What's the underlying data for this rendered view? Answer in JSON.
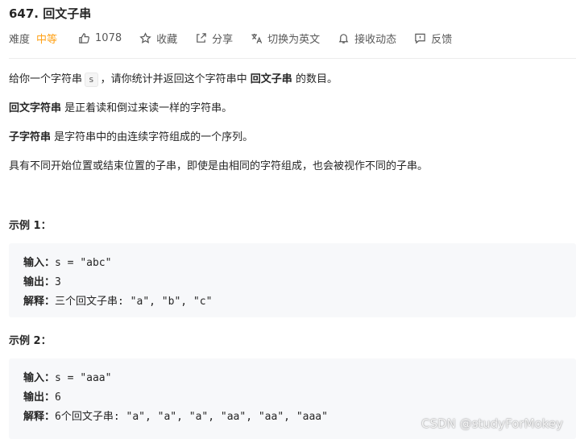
{
  "problem": {
    "title": "647. 回文子串"
  },
  "toolbar": {
    "difficulty_label": "难度",
    "difficulty_value": "中等",
    "likes": "1078",
    "favorite": "收藏",
    "share": "分享",
    "switch_lang": "切换为英文",
    "notifications": "接收动态",
    "feedback": "反馈"
  },
  "description": {
    "p1_a": "给你一个字符串",
    "p1_code": "s",
    "p1_b": "，请你统计并返回这个字符串中",
    "p1_bold": "回文子串",
    "p1_c": "的数目。",
    "p2_bold": "回文字符串",
    "p2_rest": "是正着读和倒过来读一样的字符串。",
    "p3_bold": "子字符串",
    "p3_rest": "是字符串中的由连续字符组成的一个序列。",
    "p4": "具有不同开始位置或结束位置的子串，即使是由相同的字符组成，也会被视作不同的子串。"
  },
  "examples": [
    {
      "title": "示例 1：",
      "input_label": "输入：",
      "input_value": "s = \"abc\"",
      "output_label": "输出：",
      "output_value": "3",
      "explain_label": "解释：",
      "explain_value": "三个回文子串: \"a\", \"b\", \"c\""
    },
    {
      "title": "示例 2：",
      "input_label": "输入：",
      "input_value": "s = \"aaa\"",
      "output_label": "输出：",
      "output_value": "6",
      "explain_label": "解释：",
      "explain_value": "6个回文子串: \"a\", \"a\", \"a\", \"aa\", \"aa\", \"aaa\""
    }
  ],
  "watermark": "CSDN @studyForMokey",
  "colors": {
    "difficulty_medium": "#ffa116",
    "code_bg": "#f7f8fa"
  }
}
